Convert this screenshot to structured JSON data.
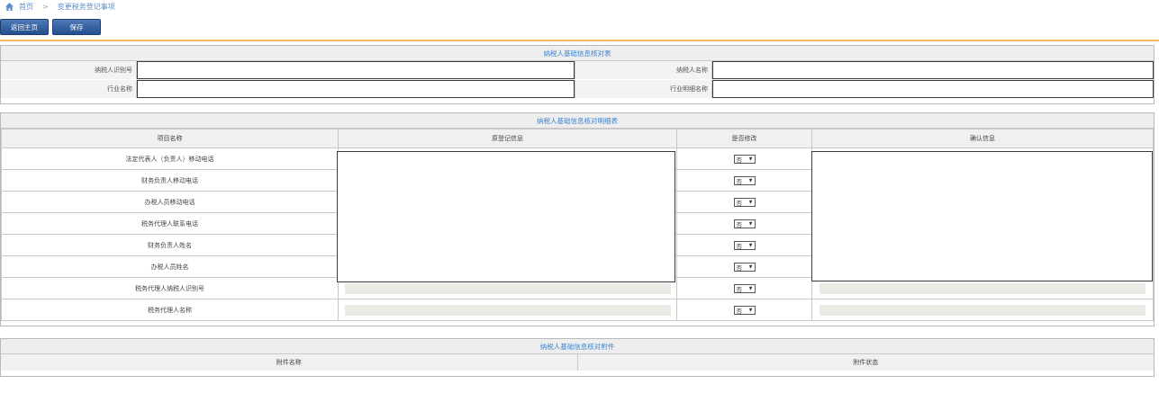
{
  "breadcrumb": {
    "home": "首页",
    "sep": ">",
    "current": "变更税务登记事项"
  },
  "toolbar": {
    "back_label": "返回主页",
    "save_label": "保存"
  },
  "basic_info": {
    "title": "纳税人基础信息核对表",
    "taxpayer_id_label": "纳税人识别号",
    "taxpayer_name_label": "纳税人名称",
    "industry_label": "行业名称",
    "industry_detail_label": "行业明细名称",
    "taxpayer_id_value": "",
    "taxpayer_name_value": "",
    "industry_value": "",
    "industry_detail_value": ""
  },
  "detail": {
    "title": "纳税人基础信息核对明细表",
    "headers": [
      "项目名称",
      "原登记信息",
      "是否修改",
      "确认信息"
    ],
    "rows": [
      {
        "name": "法定代表人（负责人）移动电话",
        "modify": "否"
      },
      {
        "name": "财务负责人移动电话",
        "modify": "否"
      },
      {
        "name": "办税人员移动电话",
        "modify": "否"
      },
      {
        "name": "税务代理人联系电话",
        "modify": "否"
      },
      {
        "name": "财务负责人姓名",
        "modify": "否"
      },
      {
        "name": "办税人员姓名",
        "modify": "否"
      },
      {
        "name": "税务代理人纳税人识别号",
        "modify": "否"
      },
      {
        "name": "税务代理人名称",
        "modify": "否"
      }
    ]
  },
  "attachments": {
    "title": "纳税人基础信息核对附件",
    "name_header": "附件名称",
    "status_header": "附件状态"
  }
}
